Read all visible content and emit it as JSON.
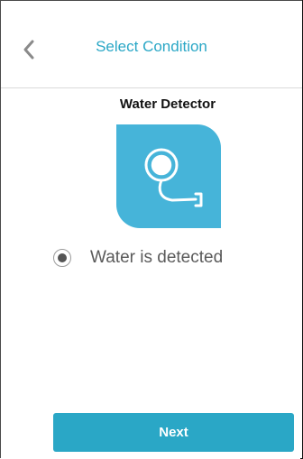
{
  "header": {
    "title": "Select Condition"
  },
  "device": {
    "name": "Water Detector",
    "icon": "water-detector-icon"
  },
  "options": [
    {
      "label": "Water is detected",
      "selected": true
    }
  ],
  "footer": {
    "next_label": "Next"
  },
  "colors": {
    "accent": "#2aa7c6",
    "icon_bg": "#46b4d9",
    "divider": "#dadada"
  }
}
